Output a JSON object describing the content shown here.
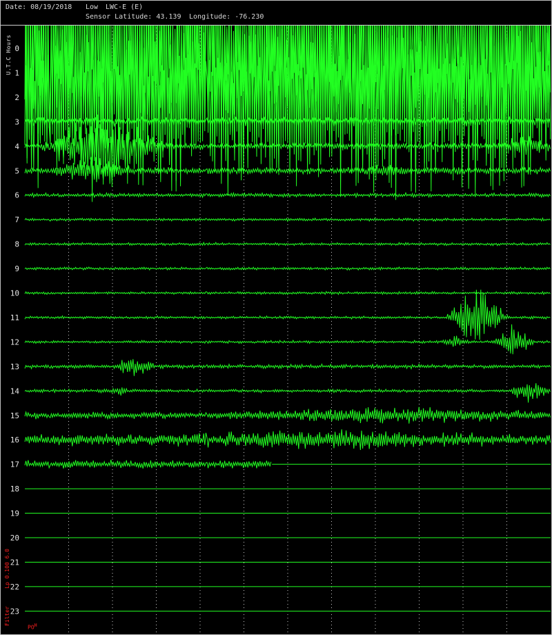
{
  "header": {
    "date": "Date: 08/19/2018",
    "gain": "Low",
    "station": "LWC-E (E)",
    "latitude": "Sensor Latitude: 43.139",
    "longitude": "Longitude: -76.230"
  },
  "chart_data": {
    "type": "line",
    "ylabel": "U.T.C Hours",
    "y_ticks": [
      "0",
      "1",
      "2",
      "3",
      "4",
      "5",
      "6",
      "7",
      "8",
      "9",
      "10",
      "11",
      "12",
      "13",
      "14",
      "15",
      "16",
      "17",
      "18",
      "19",
      "20",
      "21",
      "22",
      "23"
    ],
    "ylim": [
      0,
      23
    ],
    "grid": true,
    "trace_color": "#22ff22",
    "filter_label": "Filter",
    "filter_value": "Lp 0.100 6.0",
    "logo_text": "PO",
    "logo_sup": "H",
    "rows": [
      {
        "hour": 0,
        "activity": 8.0,
        "events": []
      },
      {
        "hour": 1,
        "activity": 8.5,
        "events": []
      },
      {
        "hour": 2,
        "activity": 6.5,
        "events": []
      },
      {
        "hour": 3,
        "activity": 0.35,
        "events": []
      },
      {
        "hour": 4,
        "activity": 0.25,
        "events": [
          {
            "at": 0.15,
            "amp": 2.2,
            "dur": 0.12
          },
          {
            "at": 0.95,
            "amp": 0.5,
            "dur": 0.06
          }
        ]
      },
      {
        "hour": 5,
        "activity": 0.25,
        "events": [
          {
            "at": 0.13,
            "amp": 0.8,
            "dur": 0.08
          },
          {
            "at": 0.68,
            "amp": 0.4,
            "dur": 0.04
          }
        ]
      },
      {
        "hour": 6,
        "activity": 0.15,
        "events": []
      },
      {
        "hour": 7,
        "activity": 0.1,
        "events": []
      },
      {
        "hour": 8,
        "activity": 0.1,
        "events": []
      },
      {
        "hour": 9,
        "activity": 0.1,
        "events": []
      },
      {
        "hour": 10,
        "activity": 0.1,
        "events": []
      },
      {
        "hour": 11,
        "activity": 0.1,
        "events": [
          {
            "at": 0.86,
            "amp": 2.0,
            "dur": 0.06
          }
        ]
      },
      {
        "hour": 12,
        "activity": 0.1,
        "events": [
          {
            "at": 0.93,
            "amp": 1.0,
            "dur": 0.04
          },
          {
            "at": 0.82,
            "amp": 0.3,
            "dur": 0.03
          }
        ]
      },
      {
        "hour": 13,
        "activity": 0.15,
        "events": [
          {
            "at": 0.21,
            "amp": 0.6,
            "dur": 0.04
          }
        ]
      },
      {
        "hour": 14,
        "activity": 0.12,
        "events": [
          {
            "at": 0.96,
            "amp": 0.7,
            "dur": 0.04
          },
          {
            "at": 0.18,
            "amp": 0.2,
            "dur": 0.02
          }
        ]
      },
      {
        "hour": 15,
        "activity": 0.25,
        "events": [
          {
            "at": 0.7,
            "amp": 0.35,
            "dur": 0.35
          }
        ]
      },
      {
        "hour": 16,
        "activity": 0.45,
        "events": [
          {
            "at": 0.6,
            "amp": 0.3,
            "dur": 0.3
          }
        ]
      },
      {
        "hour": 17,
        "activity": 0.3,
        "end": 0.47,
        "events": []
      },
      {
        "hour": 18,
        "activity": 0,
        "events": []
      },
      {
        "hour": 19,
        "activity": 0,
        "events": []
      },
      {
        "hour": 20,
        "activity": 0,
        "events": []
      },
      {
        "hour": 21,
        "activity": 0,
        "events": []
      },
      {
        "hour": 22,
        "activity": 0,
        "events": []
      },
      {
        "hour": 23,
        "activity": 0,
        "events": []
      }
    ]
  }
}
